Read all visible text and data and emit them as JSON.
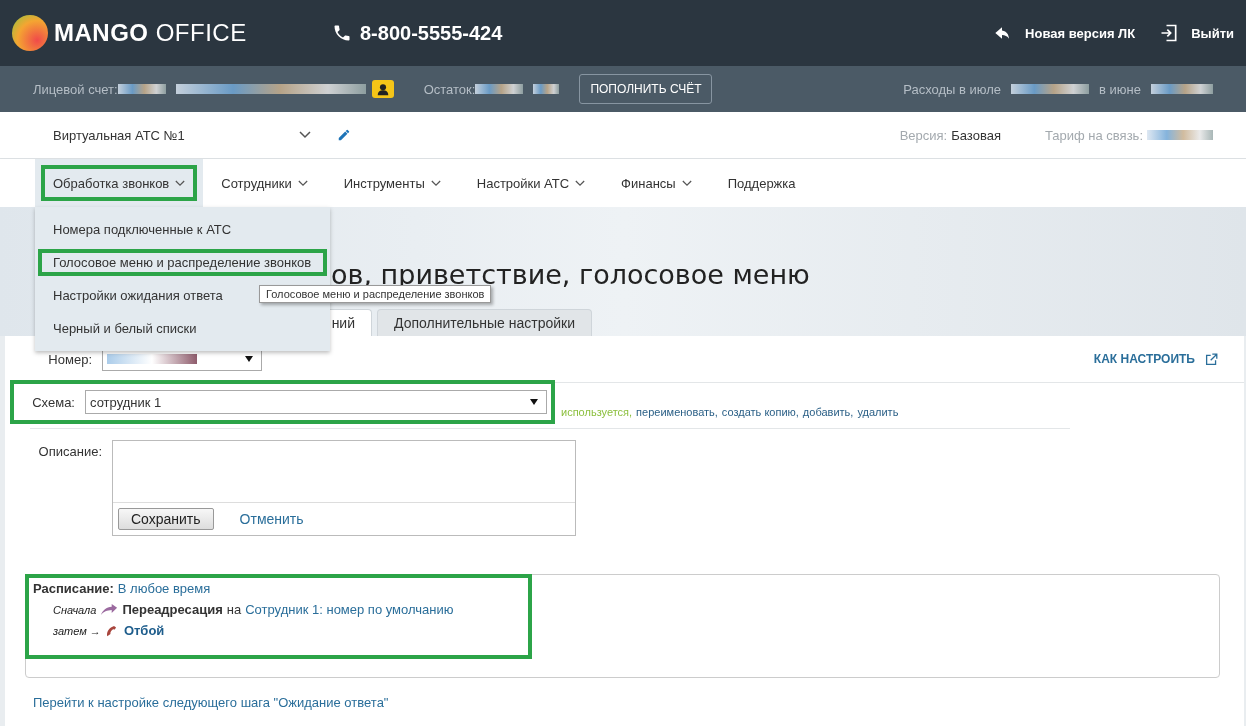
{
  "header": {
    "logo_bold": "MANGO",
    "logo_light": "OFFICE",
    "phone": "8-800-5555-424",
    "links": [
      {
        "label": "Новая версия ЛК",
        "kind": "back"
      },
      {
        "label": "Выйти",
        "kind": "exit"
      }
    ]
  },
  "account_bar": {
    "account_label": "Лицевой счет:",
    "balance_label": "Остаток:",
    "topup_button": "ПОПОЛНИТЬ СЧЁТ",
    "expenses_label": "Расходы в июле",
    "june_label": "в июне"
  },
  "pbx": {
    "name": "Виртуальная АТС №1",
    "version_label": "Версия:",
    "version": "Базовая",
    "tariff_label": "Тариф на связь:"
  },
  "nav": [
    {
      "label": "Обработка звонков",
      "has_dropdown": true,
      "selected": true,
      "highlighted": true
    },
    {
      "label": "Сотрудники",
      "has_dropdown": true,
      "selected": false,
      "highlighted": false
    },
    {
      "label": "Инструменты",
      "has_dropdown": true,
      "selected": false,
      "highlighted": false
    },
    {
      "label": "Настройки АТС",
      "has_dropdown": true,
      "selected": false,
      "highlighted": false
    },
    {
      "label": "Финансы",
      "has_dropdown": true,
      "selected": false,
      "highlighted": false
    },
    {
      "label": "Поддержка",
      "has_dropdown": false,
      "selected": false,
      "highlighted": false
    }
  ],
  "dropdown": [
    {
      "label": "Номера подключенные к АТС",
      "highlighted": false
    },
    {
      "label": "Голосовое меню и распределение звонков",
      "highlighted": true
    },
    {
      "label": "Настройки ожидания ответа",
      "highlighted": false
    },
    {
      "label": "Черный и белый списки",
      "highlighted": false
    }
  ],
  "tooltip": "Голосовое меню и распределение звонков",
  "page": {
    "title": "ов, приветствие, голосовое меню",
    "tabs": [
      {
        "label": "ний",
        "selected": true
      },
      {
        "label": "Дополнительные настройки",
        "selected": false
      }
    ],
    "help_link": "КАК НАСТРОИТЬ"
  },
  "form": {
    "number_label": "Номер:",
    "scheme_label": "Схема:",
    "scheme_value": "сотрудник 1",
    "scheme_highlighted": true,
    "scheme_status": "используется,",
    "scheme_actions": [
      "переименовать,",
      "создать копию,",
      "добавить,",
      "удалить"
    ],
    "description_label": "Описание:",
    "save_button": "Сохранить",
    "cancel_link": "Отменить"
  },
  "schedule": {
    "label": "Расписание:",
    "value": "В любое время",
    "highlighted": true,
    "steps": [
      {
        "prefix": "Сначала",
        "kind": "forward",
        "action": "Переадресация",
        "connector": "на",
        "target": "Сотрудник 1: номер по умолчанию"
      },
      {
        "prefix": "затем →",
        "kind": "hangup",
        "action": "Отбой"
      }
    ]
  },
  "next_link": "Перейти к настройке следующего шага \"Ожидание ответа\""
}
